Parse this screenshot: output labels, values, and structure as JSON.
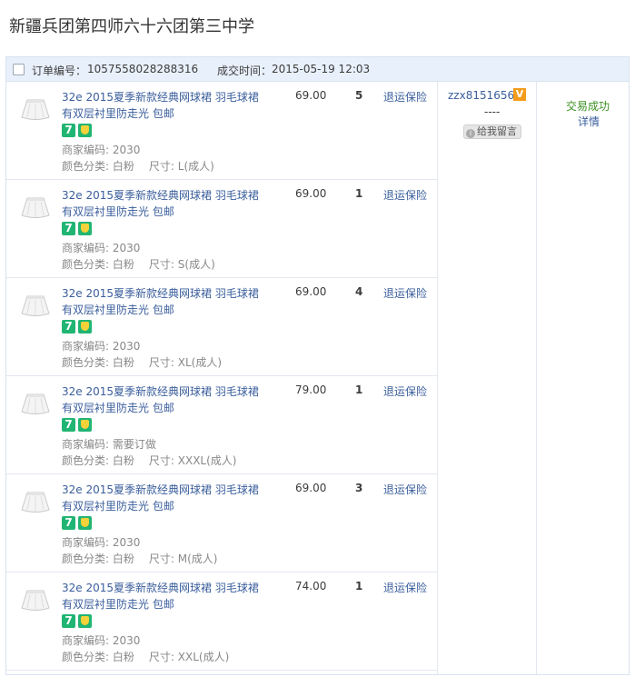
{
  "page_title": "新疆兵团第四师六十六团第三中学",
  "order": {
    "order_no_label": "订单编号：",
    "order_no": "1057558028288316",
    "time_label": "成交时间：",
    "time": "2015-05-19 12:03",
    "buyer": "zzx8151656",
    "buyer_badge": "V",
    "dashes": "----",
    "message_button": "给我留言",
    "status": "交易成功",
    "detail_link": "详情"
  },
  "labels": {
    "merchant_code": "商家编码:",
    "color": "颜色分类:",
    "size": "尺寸:",
    "insurance": "退运保险",
    "badge_seven": "7"
  },
  "items": [
    {
      "title": "32e 2015夏季新款经典网球裙 羽毛球裙有双层衬里防走光 包邮",
      "price": "69.00",
      "qty": "5",
      "code": "2030",
      "color": "白粉",
      "size": "L(成人)"
    },
    {
      "title": "32e 2015夏季新款经典网球裙 羽毛球裙有双层衬里防走光 包邮",
      "price": "69.00",
      "qty": "1",
      "code": "2030",
      "color": "白粉",
      "size": "S(成人)"
    },
    {
      "title": "32e 2015夏季新款经典网球裙 羽毛球裙有双层衬里防走光 包邮",
      "price": "69.00",
      "qty": "4",
      "code": "2030",
      "color": "白粉",
      "size": "XL(成人)"
    },
    {
      "title": "32e 2015夏季新款经典网球裙 羽毛球裙有双层衬里防走光 包邮",
      "price": "79.00",
      "qty": "1",
      "code": "需要订做",
      "color": "白粉",
      "size": "XXXL(成人)"
    },
    {
      "title": "32e 2015夏季新款经典网球裙 羽毛球裙有双层衬里防走光 包邮",
      "price": "69.00",
      "qty": "3",
      "code": "2030",
      "color": "白粉",
      "size": "M(成人)"
    },
    {
      "title": "32e 2015夏季新款经典网球裙 羽毛球裙有双层衬里防走光 包邮",
      "price": "74.00",
      "qty": "1",
      "code": "2030",
      "color": "白粉",
      "size": "XXL(成人)"
    }
  ],
  "icons": {
    "checkbox": "checkbox-icon",
    "thumbnail": "skirt-thumbnail-icon",
    "seven_day": "seven-day-return-icon",
    "guarantee": "consumer-guarantee-icon",
    "vip": "vip-badge-icon"
  },
  "colors": {
    "link": "#3a5e9c",
    "status": "#3a8f20",
    "header_bg": "#e8f0fb",
    "badge": "#21b573"
  }
}
